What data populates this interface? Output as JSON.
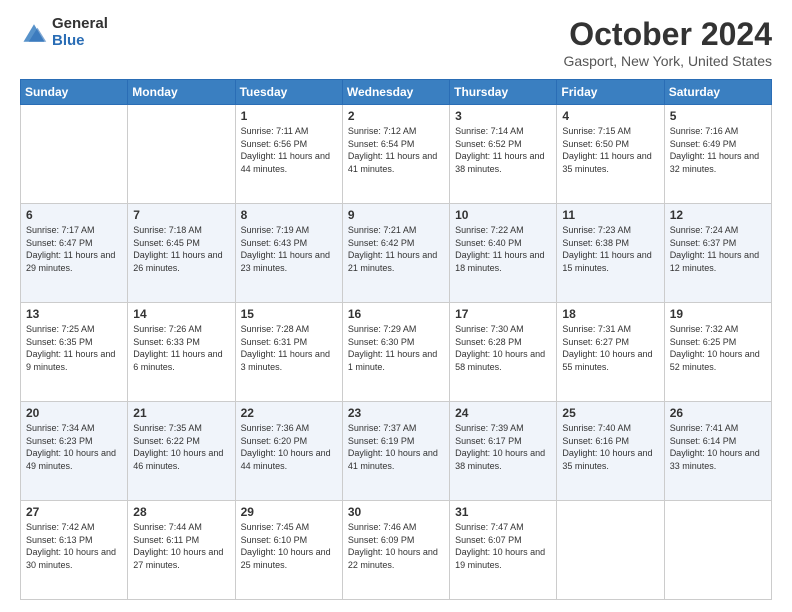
{
  "logo": {
    "general": "General",
    "blue": "Blue"
  },
  "title": {
    "month_year": "October 2024",
    "location": "Gasport, New York, United States"
  },
  "weekdays": [
    "Sunday",
    "Monday",
    "Tuesday",
    "Wednesday",
    "Thursday",
    "Friday",
    "Saturday"
  ],
  "weeks": [
    [
      {
        "day": "",
        "sunrise": "",
        "sunset": "",
        "daylight": ""
      },
      {
        "day": "",
        "sunrise": "",
        "sunset": "",
        "daylight": ""
      },
      {
        "day": "1",
        "sunrise": "Sunrise: 7:11 AM",
        "sunset": "Sunset: 6:56 PM",
        "daylight": "Daylight: 11 hours and 44 minutes."
      },
      {
        "day": "2",
        "sunrise": "Sunrise: 7:12 AM",
        "sunset": "Sunset: 6:54 PM",
        "daylight": "Daylight: 11 hours and 41 minutes."
      },
      {
        "day": "3",
        "sunrise": "Sunrise: 7:14 AM",
        "sunset": "Sunset: 6:52 PM",
        "daylight": "Daylight: 11 hours and 38 minutes."
      },
      {
        "day": "4",
        "sunrise": "Sunrise: 7:15 AM",
        "sunset": "Sunset: 6:50 PM",
        "daylight": "Daylight: 11 hours and 35 minutes."
      },
      {
        "day": "5",
        "sunrise": "Sunrise: 7:16 AM",
        "sunset": "Sunset: 6:49 PM",
        "daylight": "Daylight: 11 hours and 32 minutes."
      }
    ],
    [
      {
        "day": "6",
        "sunrise": "Sunrise: 7:17 AM",
        "sunset": "Sunset: 6:47 PM",
        "daylight": "Daylight: 11 hours and 29 minutes."
      },
      {
        "day": "7",
        "sunrise": "Sunrise: 7:18 AM",
        "sunset": "Sunset: 6:45 PM",
        "daylight": "Daylight: 11 hours and 26 minutes."
      },
      {
        "day": "8",
        "sunrise": "Sunrise: 7:19 AM",
        "sunset": "Sunset: 6:43 PM",
        "daylight": "Daylight: 11 hours and 23 minutes."
      },
      {
        "day": "9",
        "sunrise": "Sunrise: 7:21 AM",
        "sunset": "Sunset: 6:42 PM",
        "daylight": "Daylight: 11 hours and 21 minutes."
      },
      {
        "day": "10",
        "sunrise": "Sunrise: 7:22 AM",
        "sunset": "Sunset: 6:40 PM",
        "daylight": "Daylight: 11 hours and 18 minutes."
      },
      {
        "day": "11",
        "sunrise": "Sunrise: 7:23 AM",
        "sunset": "Sunset: 6:38 PM",
        "daylight": "Daylight: 11 hours and 15 minutes."
      },
      {
        "day": "12",
        "sunrise": "Sunrise: 7:24 AM",
        "sunset": "Sunset: 6:37 PM",
        "daylight": "Daylight: 11 hours and 12 minutes."
      }
    ],
    [
      {
        "day": "13",
        "sunrise": "Sunrise: 7:25 AM",
        "sunset": "Sunset: 6:35 PM",
        "daylight": "Daylight: 11 hours and 9 minutes."
      },
      {
        "day": "14",
        "sunrise": "Sunrise: 7:26 AM",
        "sunset": "Sunset: 6:33 PM",
        "daylight": "Daylight: 11 hours and 6 minutes."
      },
      {
        "day": "15",
        "sunrise": "Sunrise: 7:28 AM",
        "sunset": "Sunset: 6:31 PM",
        "daylight": "Daylight: 11 hours and 3 minutes."
      },
      {
        "day": "16",
        "sunrise": "Sunrise: 7:29 AM",
        "sunset": "Sunset: 6:30 PM",
        "daylight": "Daylight: 11 hours and 1 minute."
      },
      {
        "day": "17",
        "sunrise": "Sunrise: 7:30 AM",
        "sunset": "Sunset: 6:28 PM",
        "daylight": "Daylight: 10 hours and 58 minutes."
      },
      {
        "day": "18",
        "sunrise": "Sunrise: 7:31 AM",
        "sunset": "Sunset: 6:27 PM",
        "daylight": "Daylight: 10 hours and 55 minutes."
      },
      {
        "day": "19",
        "sunrise": "Sunrise: 7:32 AM",
        "sunset": "Sunset: 6:25 PM",
        "daylight": "Daylight: 10 hours and 52 minutes."
      }
    ],
    [
      {
        "day": "20",
        "sunrise": "Sunrise: 7:34 AM",
        "sunset": "Sunset: 6:23 PM",
        "daylight": "Daylight: 10 hours and 49 minutes."
      },
      {
        "day": "21",
        "sunrise": "Sunrise: 7:35 AM",
        "sunset": "Sunset: 6:22 PM",
        "daylight": "Daylight: 10 hours and 46 minutes."
      },
      {
        "day": "22",
        "sunrise": "Sunrise: 7:36 AM",
        "sunset": "Sunset: 6:20 PM",
        "daylight": "Daylight: 10 hours and 44 minutes."
      },
      {
        "day": "23",
        "sunrise": "Sunrise: 7:37 AM",
        "sunset": "Sunset: 6:19 PM",
        "daylight": "Daylight: 10 hours and 41 minutes."
      },
      {
        "day": "24",
        "sunrise": "Sunrise: 7:39 AM",
        "sunset": "Sunset: 6:17 PM",
        "daylight": "Daylight: 10 hours and 38 minutes."
      },
      {
        "day": "25",
        "sunrise": "Sunrise: 7:40 AM",
        "sunset": "Sunset: 6:16 PM",
        "daylight": "Daylight: 10 hours and 35 minutes."
      },
      {
        "day": "26",
        "sunrise": "Sunrise: 7:41 AM",
        "sunset": "Sunset: 6:14 PM",
        "daylight": "Daylight: 10 hours and 33 minutes."
      }
    ],
    [
      {
        "day": "27",
        "sunrise": "Sunrise: 7:42 AM",
        "sunset": "Sunset: 6:13 PM",
        "daylight": "Daylight: 10 hours and 30 minutes."
      },
      {
        "day": "28",
        "sunrise": "Sunrise: 7:44 AM",
        "sunset": "Sunset: 6:11 PM",
        "daylight": "Daylight: 10 hours and 27 minutes."
      },
      {
        "day": "29",
        "sunrise": "Sunrise: 7:45 AM",
        "sunset": "Sunset: 6:10 PM",
        "daylight": "Daylight: 10 hours and 25 minutes."
      },
      {
        "day": "30",
        "sunrise": "Sunrise: 7:46 AM",
        "sunset": "Sunset: 6:09 PM",
        "daylight": "Daylight: 10 hours and 22 minutes."
      },
      {
        "day": "31",
        "sunrise": "Sunrise: 7:47 AM",
        "sunset": "Sunset: 6:07 PM",
        "daylight": "Daylight: 10 hours and 19 minutes."
      },
      {
        "day": "",
        "sunrise": "",
        "sunset": "",
        "daylight": ""
      },
      {
        "day": "",
        "sunrise": "",
        "sunset": "",
        "daylight": ""
      }
    ]
  ]
}
